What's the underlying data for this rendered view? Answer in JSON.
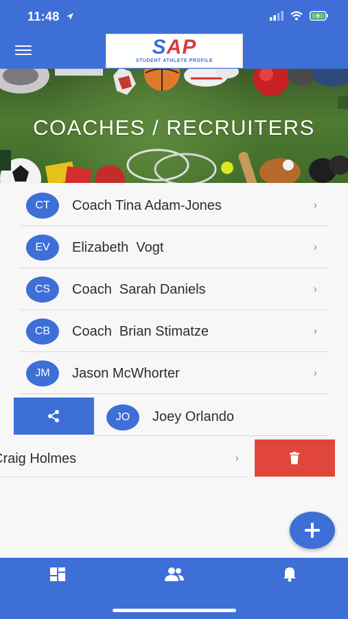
{
  "status_bar": {
    "time": "11:48"
  },
  "header": {
    "logo_text_a": "S",
    "logo_text_b": "AP",
    "logo_subtitle": "STUDENT ATHLETE PROFILE"
  },
  "hero": {
    "title": "COACHES / RECRUITERS"
  },
  "contacts": [
    {
      "initials": "CT",
      "name": "Coach Tina Adam-Jones"
    },
    {
      "initials": "EV",
      "name": "Elizabeth  Vogt"
    },
    {
      "initials": "CS",
      "name": "Coach  Sarah Daniels"
    },
    {
      "initials": "CB",
      "name": "Coach  Brian Stimatze"
    },
    {
      "initials": "JM",
      "name": "Jason McWhorter"
    },
    {
      "initials": "JO",
      "name": "Joey Orlando"
    },
    {
      "initials": "",
      "name": "Craig Holmes"
    }
  ],
  "icons": {
    "chevron": "›",
    "share": "share-icon",
    "delete": "trash-icon",
    "add": "plus-icon",
    "nav_dashboard": "dashboard-icon",
    "nav_people": "people-icon",
    "nav_notifications": "bell-icon"
  },
  "colors": {
    "primary": "#3d6fd6",
    "danger": "#e0473a",
    "logo_red": "#d63b3b"
  }
}
